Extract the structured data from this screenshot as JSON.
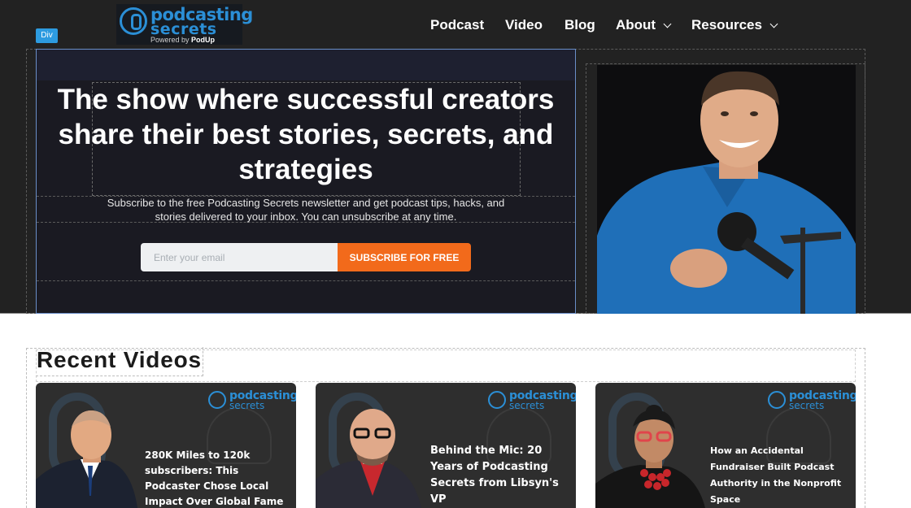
{
  "header": {
    "logo": {
      "word1": "podcasting",
      "word2": "secrets",
      "powered_prefix": "Powered by",
      "powered_brand": "PodUp"
    },
    "badge": "Div",
    "nav": [
      {
        "label": "Podcast"
      },
      {
        "label": "Video"
      },
      {
        "label": "Blog"
      },
      {
        "label": "About"
      },
      {
        "label": "Resources"
      }
    ]
  },
  "hero": {
    "headline": "The show where successful creators share their best stories, secrets, and strategies",
    "subtext": "Subscribe to the free Podcasting Secrets newsletter and get podcast tips, hacks, and stories delivered to your inbox. You can unsubscribe at any time.",
    "email_placeholder": "Enter your email",
    "email_value": "",
    "subscribe_label": "SUBSCRIBE FOR FREE"
  },
  "recent_videos": {
    "title": "Recent Videos",
    "cards": [
      {
        "title": "280K Miles to 120k subscribers: This Podcaster Chose Local Impact Over Global Fame",
        "logo1": "podcasting",
        "logo2": "secrets"
      },
      {
        "title": "Behind the Mic: 20 Years of Podcasting Secrets from Libsyn's VP",
        "logo1": "podcasting",
        "logo2": "secrets"
      },
      {
        "title": "How an Accidental Fundraiser Built Podcast Authority in the Nonprofit Space",
        "logo1": "podcasting",
        "logo2": "secrets"
      }
    ]
  },
  "colors": {
    "header_bg": "#222222",
    "accent_blue": "#2b8fd6",
    "cta_orange": "#f26a1b"
  }
}
